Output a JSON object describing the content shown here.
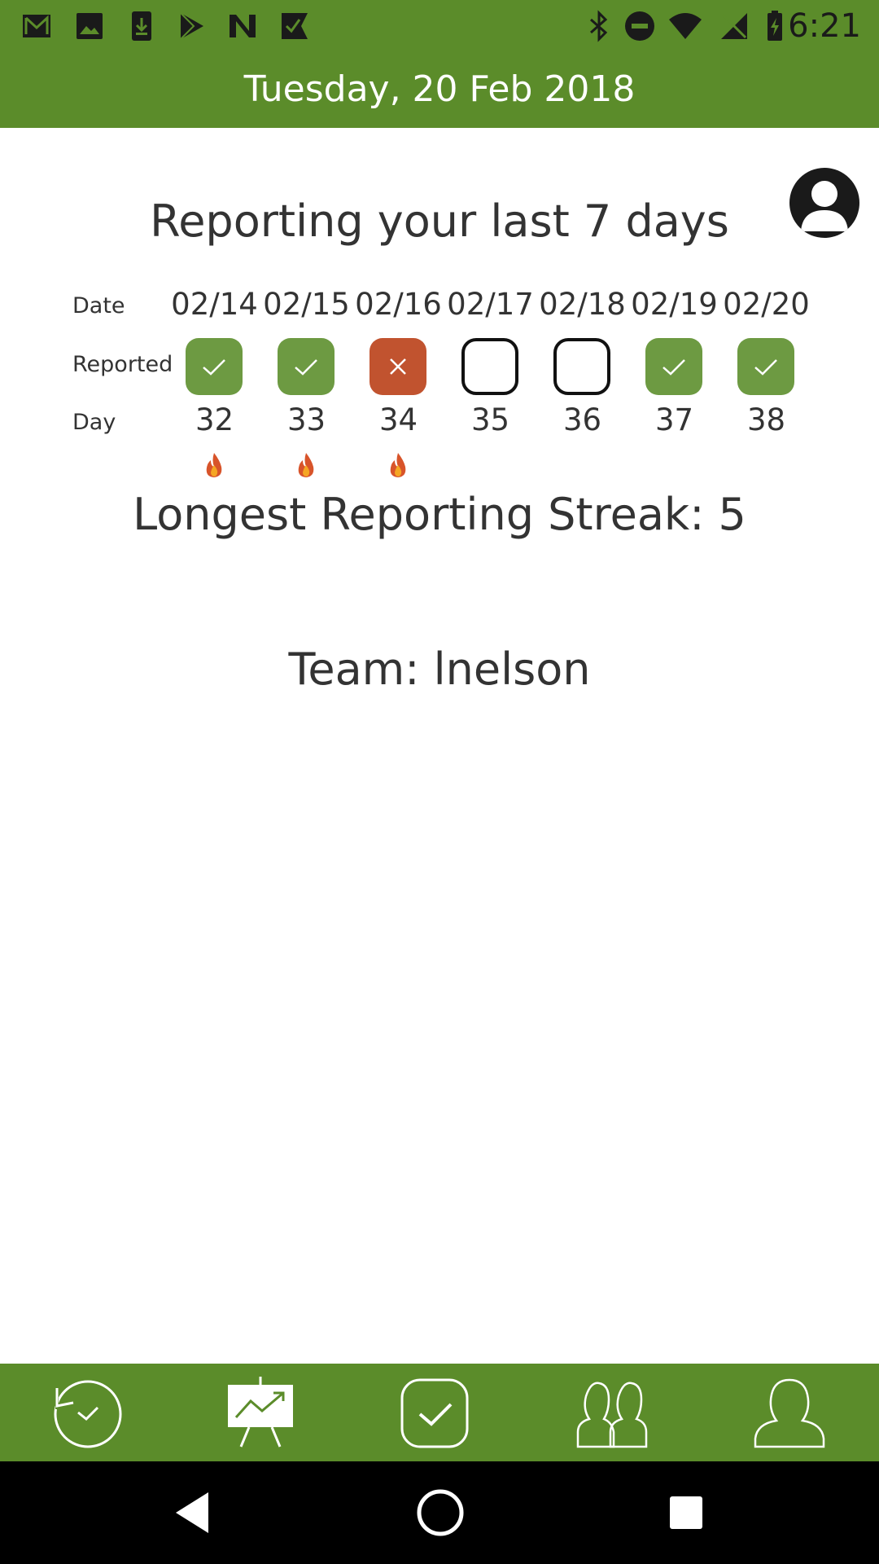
{
  "status_bar": {
    "time": "6:21",
    "left_icons": [
      "gmail-icon",
      "photo-icon",
      "download-icon",
      "play-store-icon",
      "n-app-icon",
      "checkmark-app-icon"
    ],
    "right_icons": [
      "bluetooth-icon",
      "do-not-disturb-icon",
      "wifi-icon",
      "no-signal-icon",
      "battery-charging-icon"
    ]
  },
  "header": {
    "title": "Tuesday, 20 Feb 2018"
  },
  "report": {
    "title": "Reporting your last 7 days",
    "labels": {
      "date": "Date",
      "reported": "Reported",
      "day": "Day"
    },
    "dates": [
      "02/14",
      "02/15",
      "02/16",
      "02/17",
      "02/18",
      "02/19",
      "02/20"
    ],
    "reported": [
      "yes",
      "yes",
      "no",
      "none",
      "none",
      "yes",
      "yes"
    ],
    "days": [
      "32",
      "33",
      "34",
      "35",
      "36",
      "37",
      "38"
    ],
    "streak_flames": [
      true,
      true,
      true,
      false,
      false,
      false,
      false
    ]
  },
  "streak": {
    "text": "Longest Reporting Streak: 5"
  },
  "team": {
    "text": "Team: lnelson"
  },
  "colors": {
    "brand_green": "#5b8c2a",
    "reported_green": "#6d9a42",
    "missed_red": "#c1532f"
  },
  "bottom_nav": {
    "items": [
      "history-icon",
      "trending-board-icon",
      "checkbox-icon",
      "team-icon",
      "profile-icon"
    ]
  },
  "system_nav": {
    "items": [
      "back-icon",
      "home-icon",
      "recents-icon"
    ]
  }
}
